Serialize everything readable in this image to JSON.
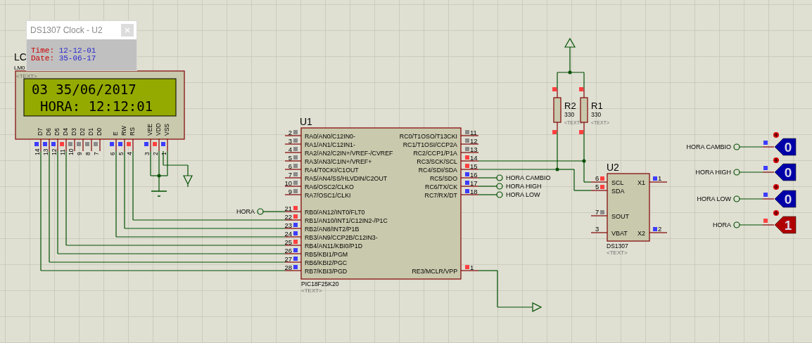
{
  "popup": {
    "title": "DS1307 Clock - U2",
    "rows": [
      {
        "label": "Time:",
        "value": "12-12-01"
      },
      {
        "label": "Date:",
        "value": "35-06-17"
      }
    ]
  },
  "lcd": {
    "reference": "LC",
    "part": "LM0",
    "text_tag": "<TEXT>",
    "display_lines": [
      "03 35/06/2017",
      "HORA: 12:12:01"
    ],
    "pins": [
      {
        "name": "D7",
        "number": "14",
        "color": "#3c3cff"
      },
      {
        "name": "D6",
        "number": "13",
        "color": "#3c3cff"
      },
      {
        "name": "D5",
        "number": "12",
        "color": "#3c3cff"
      },
      {
        "name": "D4",
        "number": "11",
        "color": "#ff4040"
      },
      {
        "name": "D3",
        "number": "10",
        "color": "#8a8a8a"
      },
      {
        "name": "D2",
        "number": "9",
        "color": "#8a8a8a"
      },
      {
        "name": "D1",
        "number": "8",
        "color": "#8a8a8a"
      },
      {
        "name": "D0",
        "number": "7",
        "color": "#8a8a8a"
      },
      {
        "name": "E",
        "number": "6",
        "color": "#3c3cff"
      },
      {
        "name": "RW",
        "number": "5",
        "color": "#3c3cff"
      },
      {
        "name": "RS",
        "number": "4",
        "color": "#ff4040"
      },
      {
        "name": "VEE",
        "number": "3",
        "color": "#3c3cff"
      },
      {
        "name": "VDD",
        "number": "2",
        "color": "#ff4040"
      },
      {
        "name": "VSS",
        "number": "1",
        "color": "#3c3cff"
      }
    ]
  },
  "mcu": {
    "reference": "U1",
    "part": "PIC18F25K20",
    "text_tag": "<TEXT>",
    "left_pins": [
      {
        "number": "2",
        "name": "RA0/AN0/C12IN0-",
        "color": "#8a8a8a"
      },
      {
        "number": "3",
        "name": "RA1/AN1/C12IN1-",
        "color": "#8a8a8a"
      },
      {
        "number": "4",
        "name": "RA2/AN2/C2IN+/VREF-/CVREF",
        "color": "#8a8a8a"
      },
      {
        "number": "5",
        "name": "RA3/AN3/C1IN+/VREF+",
        "color": "#8a8a8a"
      },
      {
        "number": "6",
        "name": "RA4/T0CKI/C1OUT",
        "color": "#8a8a8a"
      },
      {
        "number": "7",
        "name": "RA5/AN4/SS/HLVDIN/C2OUT",
        "color": "#8a8a8a"
      },
      {
        "number": "10",
        "name": "RA6/OSC2/CLKO",
        "color": "#8a8a8a"
      },
      {
        "number": "9",
        "name": "RA7/OSC1/CLKI",
        "color": "#8a8a8a"
      },
      {
        "number": "21",
        "name": "RB0/AN12/INT0/FLT0",
        "color": "#ff4040"
      },
      {
        "number": "22",
        "name": "RB1/AN10/INT1/C12IN2-/P1C",
        "color": "#ff4040"
      },
      {
        "number": "23",
        "name": "RB2/AN8/INT2/P1B",
        "color": "#3c3cff"
      },
      {
        "number": "24",
        "name": "RB3/AN9/CCP2B/C12IN3-",
        "color": "#3c3cff"
      },
      {
        "number": "25",
        "name": "RB4/AN11/KBI0/P1D",
        "color": "#ff4040"
      },
      {
        "number": "26",
        "name": "RB5/KBI1/PGM",
        "color": "#3c3cff"
      },
      {
        "number": "27",
        "name": "RB6/KBI2/PGC",
        "color": "#3c3cff"
      },
      {
        "number": "28",
        "name": "RB7/KBI3/PGD",
        "color": "#3c3cff"
      }
    ],
    "right_pins": [
      {
        "number": "11",
        "name": "RC0/T1OSO/T13CKI",
        "color": "#8a8a8a"
      },
      {
        "number": "12",
        "name": "RC1/T1OSI/CCP2A",
        "color": "#8a8a8a"
      },
      {
        "number": "13",
        "name": "RC2/CCP1/P1A",
        "color": "#8a8a8a"
      },
      {
        "number": "14",
        "name": "RC3/SCK/SCL",
        "color": "#ff4040"
      },
      {
        "number": "15",
        "name": "RC4/SDI/SDA",
        "color": "#ff4040"
      },
      {
        "number": "16",
        "name": "RC5/SDO",
        "color": "#3c3cff"
      },
      {
        "number": "17",
        "name": "RC6/TX/CK",
        "color": "#3c3cff"
      },
      {
        "number": "18",
        "name": "RC7/RX/DT",
        "color": "#3c3cff"
      },
      {
        "number": "1",
        "name": "RE3/MCLR/VPP",
        "color": "#ff4040"
      }
    ]
  },
  "net_labels": [
    {
      "label": "HORA"
    },
    {
      "label": "HORA CAMBIO"
    },
    {
      "label": "HORA HIGH"
    },
    {
      "label": "HORA LOW"
    }
  ],
  "resistors": [
    {
      "reference": "R2",
      "value": "330",
      "text_tag": "<TEXT>",
      "pins": [
        {
          "color": "#ff4040"
        },
        {
          "color": "#ff4040"
        }
      ]
    },
    {
      "reference": "R1",
      "value": "330",
      "text_tag": "<TEXT>",
      "pins": [
        {
          "color": "#ff4040"
        },
        {
          "color": "#ff4040"
        }
      ]
    }
  ],
  "rtc": {
    "reference": "U2",
    "part": "DS1307",
    "text_tag": "<TEXT>",
    "pins": [
      {
        "number": "6",
        "name": "SCL",
        "color": "#ff4040"
      },
      {
        "number": "5",
        "name": "SDA",
        "color": "#ff4040"
      },
      {
        "number": "7",
        "name": "SOUT",
        "color": "#8a8a8a"
      },
      {
        "number": "3",
        "name": "VBAT"
      },
      {
        "number": "1",
        "name": "X1",
        "color": "#3c3cff"
      },
      {
        "number": "2",
        "name": "X2",
        "color": "#3c3cff"
      }
    ]
  },
  "probes": [
    {
      "label": "HORA CAMBIO",
      "value": "0",
      "high": false,
      "color": "#3c3cff"
    },
    {
      "label": "HORA HIGH",
      "value": "0",
      "high": false,
      "color": "#3c3cff"
    },
    {
      "label": "HORA LOW",
      "value": "0",
      "high": false,
      "color": "#3c3cff"
    },
    {
      "label": "HORA",
      "value": "1",
      "high": true,
      "color": "#ff4040"
    }
  ]
}
